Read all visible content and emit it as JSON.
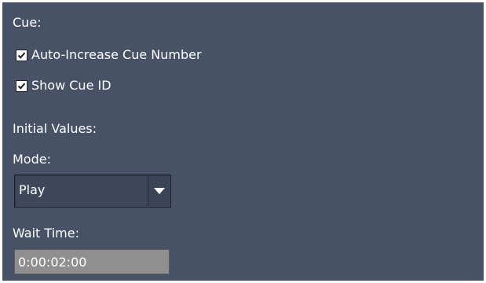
{
  "cue": {
    "section_label": "Cue:",
    "auto_increase": {
      "label": "Auto-Increase Cue Number",
      "checked": true
    },
    "show_cue_id": {
      "label": "Show Cue ID",
      "checked": true
    }
  },
  "initial_values": {
    "section_label": "Initial Values:",
    "mode": {
      "label": "Mode:",
      "selected": "Play",
      "icon": "chevron-down-icon"
    },
    "wait_time": {
      "label": "Wait Time:",
      "value": "0:00:02:00"
    }
  },
  "colors": {
    "panel_background": "#475267",
    "text": "#ffffff",
    "dropdown_background": "#3e475b",
    "wait_time_field": "#8f8f8f"
  }
}
